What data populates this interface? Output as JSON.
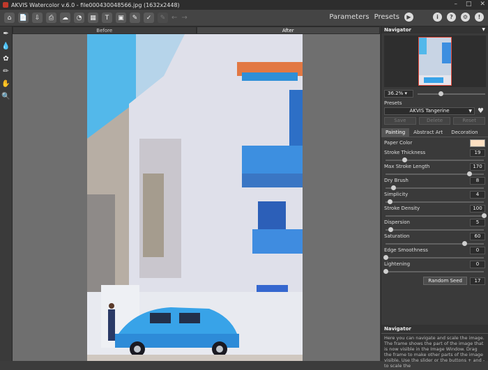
{
  "window": {
    "title": "AKVIS Watercolor v.6.0 - file0004300485​66.jpg (1632x2448)"
  },
  "window_buttons": [
    "–",
    "□",
    "✕"
  ],
  "toolbar": {
    "parameters_label": "Parameters",
    "presets_label": "Presets"
  },
  "view_tabs": {
    "before": "Before",
    "after": "After"
  },
  "navigator": {
    "title": "Navigator",
    "zoom": "36.2%"
  },
  "presets": {
    "label": "Presets",
    "selected": "AKVIS Tangerine",
    "save": "Save",
    "delete": "Delete",
    "reset": "Reset"
  },
  "param_tabs": [
    "Painting",
    "Abstract Art",
    "Decoration"
  ],
  "params": {
    "paper_color": {
      "label": "Paper Color",
      "color": "#fde0c2"
    },
    "list": [
      {
        "label": "Stroke Thickness",
        "value": "19",
        "level": 0.19
      },
      {
        "label": "Max Stroke Length",
        "value": "170",
        "level": 0.85
      },
      {
        "label": "Dry Brush",
        "value": "8",
        "level": 0.08
      },
      {
        "label": "Simplicity",
        "value": "4",
        "level": 0.04
      },
      {
        "label": "Stroke Density",
        "value": "100",
        "level": 1.0
      },
      {
        "label": "Dispersion",
        "value": "5",
        "level": 0.05
      },
      {
        "label": "Saturation",
        "value": "60",
        "level": 0.8
      },
      {
        "label": "Edge Smoothness",
        "value": "0",
        "level": 0.0
      },
      {
        "label": "Lightening",
        "value": "0",
        "level": 0.0
      }
    ],
    "random_seed_label": "Random Seed",
    "random_seed_value": "17"
  },
  "help": {
    "title": "Navigator",
    "text": "Here you can navigate and scale the image. The frame shows the part of the image that is now visible in the Image Window. Drag the frame to make other parts of the image visible. Use the slider or the buttons + and - to scale the"
  }
}
